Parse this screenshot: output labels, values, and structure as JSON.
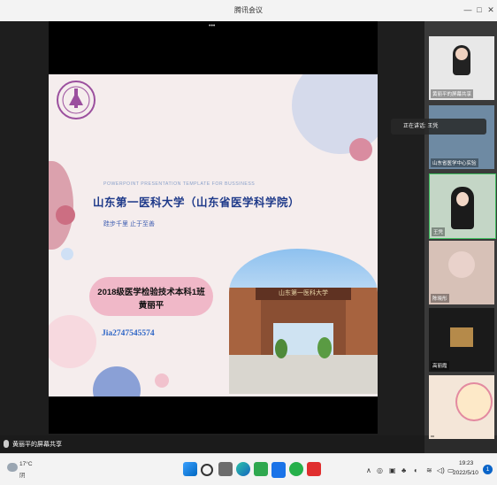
{
  "window": {
    "title": "腾讯会议"
  },
  "slide": {
    "ppt_template": "POWERPOINT PRESENTATION TEMPLATE FOR BUSSINESS",
    "university": "山东第一医科大学（山东省医学科学院）",
    "motto": "跬步千里 止于至善",
    "class_line1": "2018级医学检验技术本科1班",
    "class_line2": "黄丽平",
    "id_text": "Jia2747545574",
    "gate_text": "山东第一医科大学"
  },
  "speaking": {
    "label": "正在讲话: 王凭"
  },
  "participants": [
    {
      "name": "黄丽平的屏幕共享"
    },
    {
      "name": "山东省医学中心实验"
    },
    {
      "name": "王凭"
    },
    {
      "name": "陈晓彤"
    },
    {
      "name": "高丽霞"
    },
    {
      "name": ""
    }
  ],
  "share_bar": {
    "label": "黄丽平的屏幕共享"
  },
  "taskbar": {
    "weather_temp": "17°C",
    "weather_cond": "阴",
    "time": "19:23",
    "date": "2022/5/10",
    "notification_count": "1"
  },
  "colors": {
    "slide_bg": "#f5eded",
    "title_blue": "#1f3a8a",
    "pink": "#f0b8c8"
  }
}
